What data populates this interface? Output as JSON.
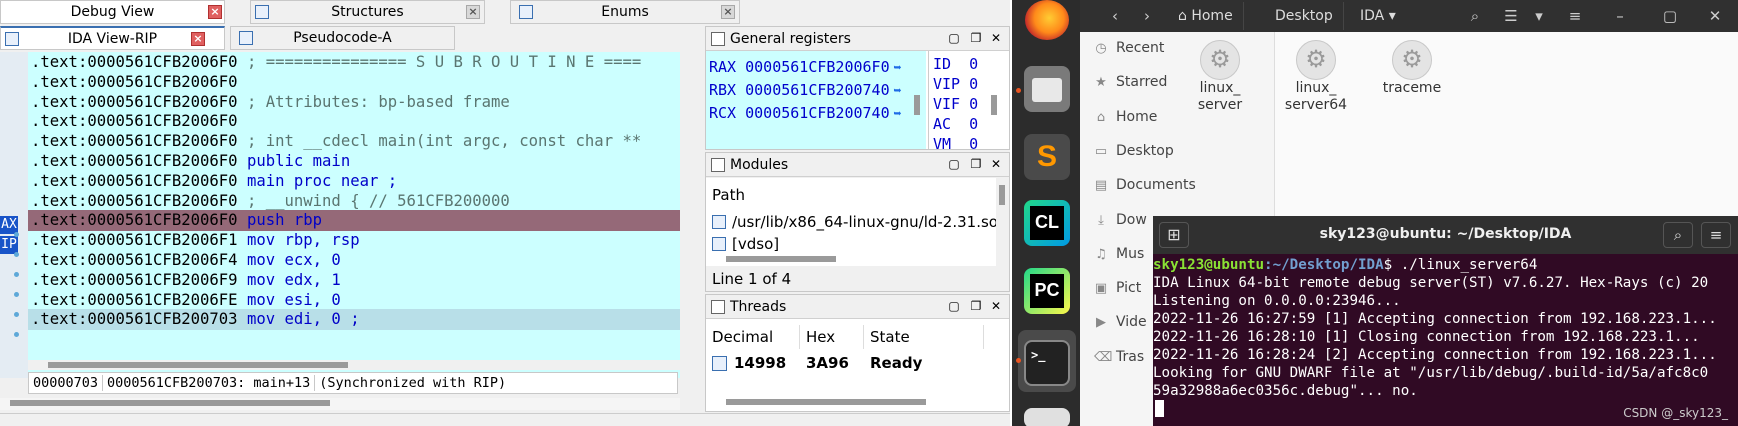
{
  "ida": {
    "tabs_top": [
      {
        "label": "Debug View"
      },
      {
        "label": "Structures"
      },
      {
        "label": "Enums"
      }
    ],
    "tabs_view": [
      {
        "label": "IDA View-RIP"
      },
      {
        "label": "Pseudocode-A"
      }
    ],
    "reg_tags": [
      "AX",
      "IP"
    ],
    "lines": [
      {
        "addr": ".text:0000561CFB2006F0",
        "text": "; =============== S U B R O U T I N E ===="
      },
      {
        "addr": ".text:0000561CFB2006F0",
        "text": ""
      },
      {
        "addr": ".text:0000561CFB2006F0",
        "text": "; Attributes: bp-based frame"
      },
      {
        "addr": ".text:0000561CFB2006F0",
        "text": ""
      },
      {
        "addr": ".text:0000561CFB2006F0",
        "text": "; int __cdecl main(int argc, const char **"
      },
      {
        "addr": ".text:0000561CFB2006F0",
        "text": "public main"
      },
      {
        "addr": ".text:0000561CFB2006F0",
        "text": "main proc near                          ;"
      },
      {
        "addr": ".text:0000561CFB2006F0",
        "text": "; __unwind { // 561CFB200000"
      },
      {
        "addr": ".text:0000561CFB2006F0",
        "text": "push    rbp"
      },
      {
        "addr": ".text:0000561CFB2006F1",
        "text": "mov     rbp, rsp"
      },
      {
        "addr": ".text:0000561CFB2006F4",
        "text": "mov     ecx, 0"
      },
      {
        "addr": ".text:0000561CFB2006F9",
        "text": "mov     edx, 1"
      },
      {
        "addr": ".text:0000561CFB2006FE",
        "text": "mov     esi, 0"
      },
      {
        "addr": ".text:0000561CFB200703",
        "text": "mov     edi, 0                          ;"
      }
    ],
    "status": {
      "offset": "00000703",
      "location": "0000561CFB200703: main+13",
      "sync": "(Synchronized with RIP)"
    },
    "gen_regs": {
      "title": "General registers",
      "rows": [
        {
          "name": "RAX",
          "value": "0000561CFB2006F0"
        },
        {
          "name": "RBX",
          "value": "0000561CFB200740"
        },
        {
          "name": "RCX",
          "value": "0000561CFB200740"
        }
      ],
      "flags": [
        {
          "name": "ID",
          "value": "0"
        },
        {
          "name": "VIP",
          "value": "0"
        },
        {
          "name": "VIF",
          "value": "0"
        },
        {
          "name": "AC",
          "value": "0"
        },
        {
          "name": "VM",
          "value": "0"
        }
      ]
    },
    "modules": {
      "title": "Modules",
      "column": "Path",
      "rows": [
        "/usr/lib/x86_64-linux-gnu/ld-2.31.so",
        "[vdso]"
      ],
      "footer": "Line 1 of 4"
    },
    "threads": {
      "title": "Threads",
      "columns": [
        "Decimal",
        "Hex",
        "State"
      ],
      "row": {
        "decimal": "14998",
        "hex": "3A96",
        "state": "Ready"
      }
    }
  },
  "dock": {
    "apps": [
      {
        "name": "firefox-icon"
      },
      {
        "name": "files-icon"
      },
      {
        "name": "sublime-icon",
        "glyph": "S"
      },
      {
        "name": "clion-icon",
        "glyph": "CL"
      },
      {
        "name": "pycharm-icon",
        "glyph": "PC"
      },
      {
        "name": "terminal-icon",
        "glyph": ">_"
      }
    ]
  },
  "files": {
    "breadcrumbs": [
      "Home",
      "Desktop",
      "IDA"
    ],
    "sidebar": [
      {
        "label": "Recent",
        "icon": "◷"
      },
      {
        "label": "Starred",
        "icon": "★"
      },
      {
        "label": "Home",
        "icon": "⌂"
      },
      {
        "label": "Desktop",
        "icon": "▭"
      },
      {
        "label": "Documents",
        "icon": "▤"
      },
      {
        "label": "Dow",
        "icon": "⤓"
      },
      {
        "label": "Mus",
        "icon": "♫"
      },
      {
        "label": "Pict",
        "icon": "▣"
      },
      {
        "label": "Vide",
        "icon": "▶"
      },
      {
        "label": "Tras",
        "icon": "⌫"
      }
    ],
    "items": [
      {
        "line1": "linux_",
        "line2": "server"
      },
      {
        "line1": "linux_",
        "line2": "server64"
      },
      {
        "line1": "traceme",
        "line2": ""
      }
    ]
  },
  "terminal": {
    "title": "sky123@ubuntu: ~/Desktop/IDA",
    "prompt_user": "sky123@ubuntu",
    "prompt_path": ":~/Desktop/IDA",
    "command": "$ ./linux_server64",
    "output": [
      "IDA Linux 64-bit remote debug server(ST) v7.6.27. Hex-Rays (c) 20",
      "Listening on 0.0.0.0:23946...",
      "2022-11-26 16:27:59 [1] Accepting connection from 192.168.223.1...",
      "2022-11-26 16:28:10 [1] Closing connection from 192.168.223.1...",
      "2022-11-26 16:28:24 [2] Accepting connection from 192.168.223.1...",
      "Looking for GNU DWARF file at \"/usr/lib/debug/.build-id/5a/afc8c0",
      "59a32988a6ec0356c.debug\"... no."
    ],
    "watermark": "CSDN @_sky123_"
  }
}
